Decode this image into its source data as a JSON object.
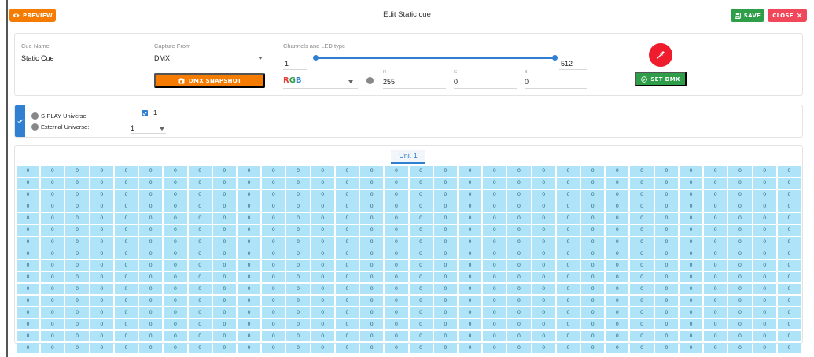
{
  "header": {
    "preview_label": "PREVIEW",
    "title": "Edit Static cue",
    "save_label": "SAVE",
    "close_label": "CLOSE"
  },
  "cue": {
    "name_label": "Cue Name",
    "name_value": "Static Cue"
  },
  "capture": {
    "label": "Capture From",
    "value": "DMX",
    "snapshot_label": "DMX SNAPSHOT"
  },
  "channels": {
    "label": "Channels and LED type",
    "min": "1",
    "max": "512",
    "range_start_fraction": 0,
    "range_end_fraction": 1,
    "led_type": "RGB",
    "r_label": "R",
    "r_value": "255",
    "g_label": "G",
    "g_value": "0",
    "b_label": "B",
    "b_value": "0",
    "set_dmx_label": "SET DMX"
  },
  "colors": {
    "accent_orange": "#f57c00",
    "save_green": "#2e9e48",
    "close_red": "#f0485a",
    "picker_red": "#ee1c2c",
    "primary_blue": "#2f7fd2",
    "cell_blue": "#aee3f8"
  },
  "universe": {
    "splay_label": "S-PLAY Universe:",
    "splay_checked": true,
    "splay_value": "1",
    "external_label": "External Universe:",
    "external_value": "1"
  },
  "tabs": [
    {
      "label": "Uni. 1"
    }
  ],
  "dmx": {
    "rows": 16,
    "cols": 32,
    "values": [
      [
        0,
        0,
        0,
        0,
        0,
        0,
        0,
        0,
        0,
        0,
        0,
        0,
        0,
        0,
        0,
        0,
        0,
        0,
        0,
        0,
        0,
        0,
        0,
        0,
        0,
        0,
        0,
        0,
        0,
        0,
        0,
        0
      ],
      [
        0,
        0,
        0,
        0,
        0,
        0,
        0,
        0,
        0,
        0,
        0,
        0,
        0,
        0,
        0,
        0,
        0,
        0,
        0,
        0,
        0,
        0,
        0,
        0,
        0,
        0,
        0,
        0,
        0,
        0,
        0,
        0
      ],
      [
        0,
        0,
        0,
        0,
        0,
        0,
        0,
        0,
        0,
        0,
        0,
        0,
        0,
        0,
        0,
        0,
        0,
        0,
        0,
        0,
        0,
        0,
        0,
        0,
        0,
        0,
        0,
        0,
        0,
        0,
        0,
        0
      ],
      [
        0,
        0,
        0,
        0,
        0,
        0,
        0,
        0,
        0,
        0,
        0,
        0,
        0,
        0,
        0,
        0,
        0,
        0,
        0,
        0,
        0,
        0,
        0,
        0,
        0,
        0,
        0,
        0,
        0,
        0,
        0,
        0
      ],
      [
        0,
        0,
        0,
        0,
        0,
        0,
        0,
        0,
        0,
        0,
        0,
        0,
        0,
        0,
        0,
        0,
        0,
        0,
        0,
        0,
        0,
        0,
        0,
        0,
        0,
        0,
        0,
        0,
        0,
        0,
        0,
        0
      ],
      [
        0,
        0,
        0,
        0,
        0,
        0,
        0,
        0,
        0,
        0,
        0,
        0,
        0,
        0,
        0,
        0,
        0,
        0,
        0,
        0,
        0,
        0,
        0,
        0,
        0,
        0,
        0,
        0,
        0,
        0,
        0,
        0
      ],
      [
        0,
        0,
        0,
        0,
        0,
        0,
        0,
        0,
        0,
        0,
        0,
        0,
        0,
        0,
        0,
        0,
        0,
        0,
        0,
        0,
        0,
        0,
        0,
        0,
        0,
        0,
        0,
        0,
        0,
        0,
        0,
        0
      ],
      [
        0,
        0,
        0,
        0,
        0,
        0,
        0,
        0,
        0,
        0,
        0,
        0,
        0,
        0,
        0,
        0,
        0,
        0,
        0,
        0,
        0,
        0,
        0,
        0,
        0,
        0,
        0,
        0,
        0,
        0,
        0,
        0
      ],
      [
        0,
        0,
        0,
        0,
        0,
        0,
        0,
        0,
        0,
        0,
        0,
        0,
        0,
        0,
        0,
        0,
        0,
        0,
        0,
        0,
        0,
        0,
        0,
        0,
        0,
        0,
        0,
        0,
        0,
        0,
        0,
        0
      ],
      [
        0,
        0,
        0,
        0,
        0,
        0,
        0,
        0,
        0,
        0,
        0,
        0,
        0,
        0,
        0,
        0,
        0,
        0,
        0,
        0,
        0,
        0,
        0,
        0,
        0,
        0,
        0,
        0,
        0,
        0,
        0,
        0
      ],
      [
        0,
        0,
        0,
        0,
        0,
        0,
        0,
        0,
        0,
        0,
        0,
        0,
        0,
        0,
        0,
        0,
        0,
        0,
        0,
        0,
        0,
        0,
        0,
        0,
        0,
        0,
        0,
        0,
        0,
        0,
        0,
        0
      ],
      [
        0,
        0,
        0,
        0,
        0,
        0,
        0,
        0,
        0,
        0,
        0,
        0,
        0,
        0,
        0,
        0,
        0,
        0,
        0,
        0,
        0,
        0,
        0,
        0,
        0,
        0,
        0,
        0,
        0,
        0,
        0,
        0
      ],
      [
        0,
        0,
        0,
        0,
        0,
        0,
        0,
        0,
        0,
        0,
        0,
        0,
        0,
        0,
        0,
        0,
        0,
        0,
        0,
        0,
        0,
        0,
        0,
        0,
        0,
        0,
        0,
        0,
        0,
        0,
        0,
        0
      ],
      [
        0,
        0,
        0,
        0,
        0,
        0,
        0,
        0,
        0,
        0,
        0,
        0,
        0,
        0,
        0,
        0,
        0,
        0,
        0,
        0,
        0,
        0,
        0,
        0,
        0,
        0,
        0,
        0,
        0,
        0,
        0,
        0
      ],
      [
        0,
        0,
        0,
        0,
        0,
        0,
        0,
        0,
        0,
        0,
        0,
        0,
        0,
        0,
        0,
        0,
        0,
        0,
        0,
        0,
        0,
        0,
        0,
        0,
        0,
        0,
        0,
        0,
        0,
        0,
        0,
        0
      ],
      [
        0,
        0,
        0,
        0,
        0,
        0,
        0,
        0,
        0,
        0,
        0,
        0,
        0,
        0,
        0,
        0,
        0,
        0,
        0,
        0,
        0,
        0,
        0,
        0,
        0,
        0,
        0,
        0,
        0,
        0,
        0,
        0
      ]
    ]
  }
}
